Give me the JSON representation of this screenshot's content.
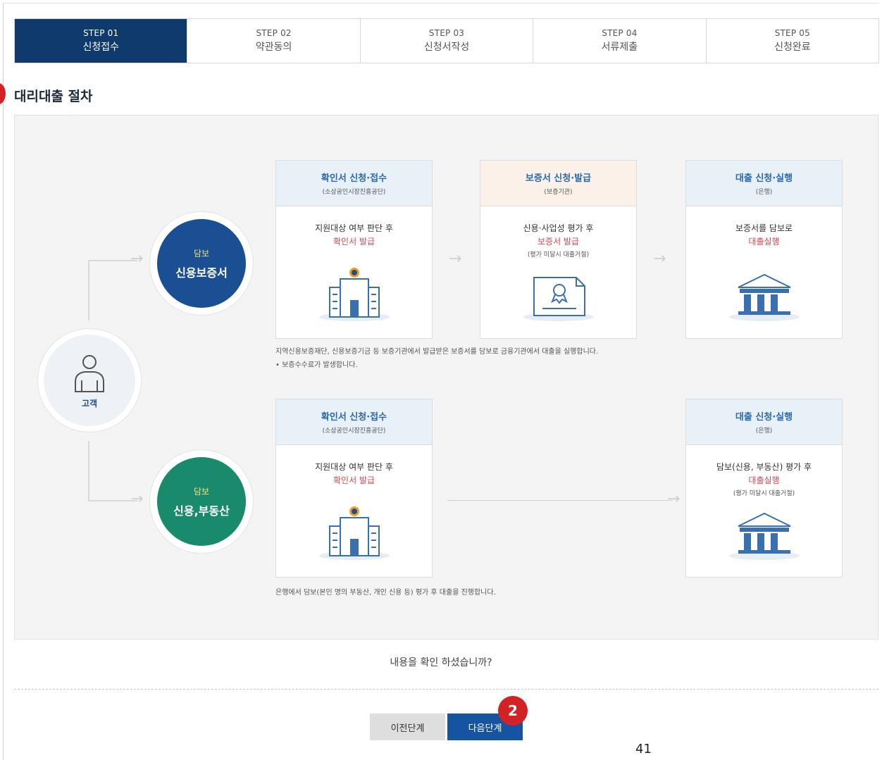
{
  "steps": [
    {
      "num": "STEP 01",
      "name": "신청접수"
    },
    {
      "num": "STEP 02",
      "name": "약관동의"
    },
    {
      "num": "STEP 03",
      "name": "신청서작성"
    },
    {
      "num": "STEP 04",
      "name": "서류제출"
    },
    {
      "num": "STEP 05",
      "name": "신청완료"
    }
  ],
  "page_title": "대리대출 절차",
  "customer": {
    "label": "고객"
  },
  "route1": {
    "circle_tag": "담보",
    "circle_title": "신용보증서",
    "cards": [
      {
        "title": "확인서 신청·접수",
        "sub": "(소상공인시장진흥공단)",
        "line1": "지원대상 여부 판단 후",
        "line2": "확인서 발급",
        "line3": ""
      },
      {
        "title": "보증서 신청·발급",
        "sub": "(보증기관)",
        "line1": "신용·사업성 평가 후",
        "line2": "보증서 발급",
        "line3": "(평가 미달시 대출거절)"
      },
      {
        "title": "대출 신청·실행",
        "sub": "(은행)",
        "line1": "보증서를 담보로",
        "line2": "대출실행",
        "line3": ""
      }
    ],
    "note1": "지역신용보증재단, 신용보증기금 등 보증기관에서 발급받은 보증서를 담보로 금융기관에서 대출을 실행합니다.",
    "note2": "• 보증수수료가 발생합니다."
  },
  "route2": {
    "circle_tag": "담보",
    "circle_title": "신용,부동산",
    "cards": [
      {
        "title": "확인서 신청·접수",
        "sub": "(소상공인시장진흥공단)",
        "line1": "지원대상 여부 판단 후",
        "line2": "확인서 발급",
        "line3": ""
      },
      {
        "title": "대출 신청·실행",
        "sub": "(은행)",
        "line1": "담보(신용, 부동산) 평가 후",
        "line2": "대출실행",
        "line3": "(평가 미달시 대출거절)"
      }
    ],
    "note1": "은행에서 담보(본인 명의 부동산, 개인 신용 등) 평가 후 대출을 진행합니다."
  },
  "question": "내용을 확인 하셨습니까?",
  "buttons": {
    "prev": "이전단계",
    "next": "다음단계"
  },
  "badge": "2",
  "page_number": "41",
  "colors": {
    "active_step": "#0e3a6e",
    "route1_circle": "#1a4f93",
    "route2_circle": "#1a8a6c",
    "highlight_text": "#e2464d",
    "next_button": "#1653a0"
  }
}
